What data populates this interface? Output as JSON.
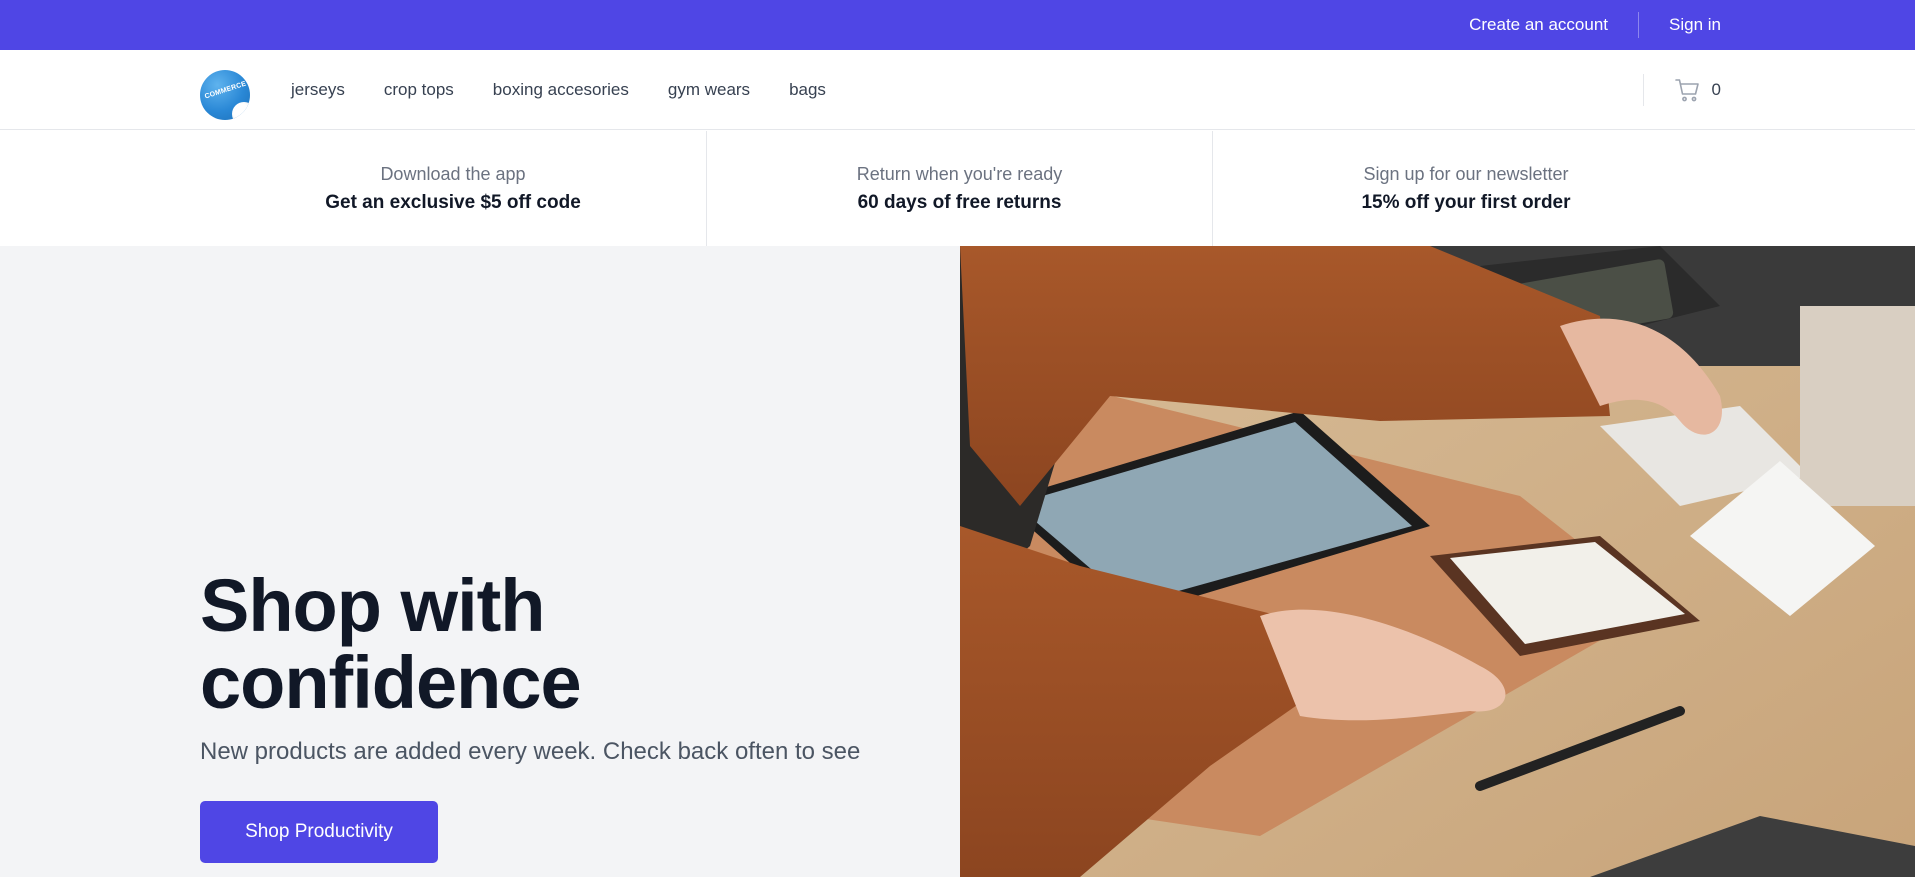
{
  "topbar": {
    "create_account": "Create an account",
    "sign_in": "Sign in",
    "background": "#4f46e5"
  },
  "nav": {
    "logo_text": "COMMERCE",
    "links": [
      {
        "label": "jerseys"
      },
      {
        "label": "crop tops"
      },
      {
        "label": "boxing accesories"
      },
      {
        "label": "gym wears"
      },
      {
        "label": "bags"
      }
    ],
    "cart_icon": "shopping-cart-icon",
    "cart_count": "0"
  },
  "perks": [
    {
      "sub": "Download the app",
      "main": "Get an exclusive $5 off code"
    },
    {
      "sub": "Return when you're ready",
      "main": "60 days of free returns"
    },
    {
      "sub": "Sign up for our newsletter",
      "main": "15% off your first order"
    }
  ],
  "hero": {
    "title_line1": "Shop with",
    "title_line2": "confidence",
    "subtitle": "New products are added every week. Check back often to see",
    "button_label": "Shop Productivity",
    "accent": "#4f46e5"
  }
}
